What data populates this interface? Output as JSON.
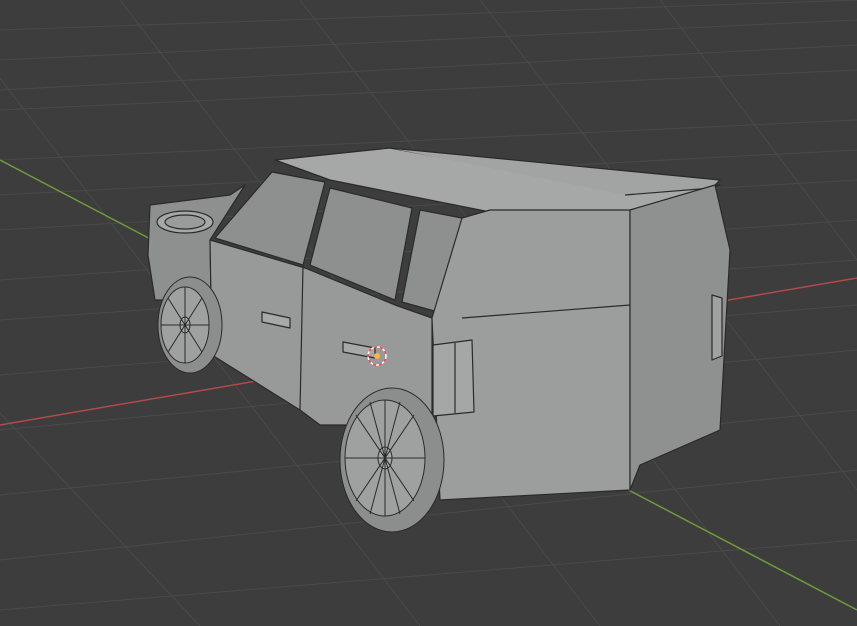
{
  "app": "Blender",
  "viewport": {
    "mode": "Solid",
    "object": "car-body",
    "colors": {
      "background": "#3d3d3d",
      "grid": "#4a4a4a",
      "x_axis": "#b34a4a",
      "y_axis": "#6f9a3c",
      "mesh_face": "#9b9d9c",
      "mesh_face_dark": "#858786",
      "mesh_edge": "#2a2a2a",
      "origin": "#ff6a4a"
    },
    "icons": [
      "3d-cursor-icon"
    ]
  }
}
